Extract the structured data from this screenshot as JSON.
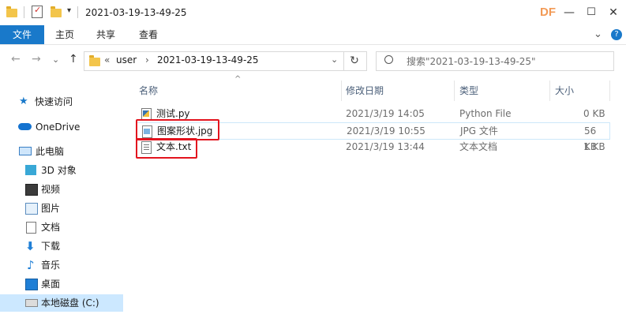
{
  "window": {
    "title": "2021-03-19-13-49-25",
    "watermark": "DF",
    "minimize": "—",
    "maximize": "☐",
    "close": "✕"
  },
  "ribbon": {
    "tabs": [
      "文件",
      "主页",
      "共享",
      "查看"
    ],
    "expand": "⌄",
    "help": "?"
  },
  "address": {
    "back": "←",
    "forward": "→",
    "recent": "⌄",
    "up": "↑",
    "overflow": "«",
    "crumbs": [
      "user",
      "2021-03-19-13-49-25"
    ],
    "crumb_sep": "›",
    "dropdown": "⌄",
    "refresh": "↻",
    "search_placeholder": "搜索\"2021-03-19-13-49-25\""
  },
  "nav": {
    "quick_access": "快速访问",
    "onedrive": "OneDrive",
    "this_pc": "此电脑",
    "items": [
      "3D 对象",
      "视频",
      "图片",
      "文档",
      "下载",
      "音乐",
      "桌面",
      "本地磁盘 (C:)"
    ]
  },
  "columns": {
    "name": "名称",
    "modified": "修改日期",
    "type": "类型",
    "size": "大小",
    "sort_indicator": "^"
  },
  "files": [
    {
      "name": "测试.py",
      "modified": "2021/3/19 14:05",
      "type": "Python File",
      "size": "0 KB"
    },
    {
      "name": "图案形状.jpg",
      "modified": "2021/3/19 10:55",
      "type": "JPG 文件",
      "size": "56 KB"
    },
    {
      "name": "文本.txt",
      "modified": "2021/3/19 13:44",
      "type": "文本文档",
      "size": "1 KB"
    }
  ],
  "colors": {
    "accent": "#1979ca",
    "highlight": "#e3141e",
    "selected_nav": "#cce8ff",
    "watermark": "#f29a56"
  }
}
